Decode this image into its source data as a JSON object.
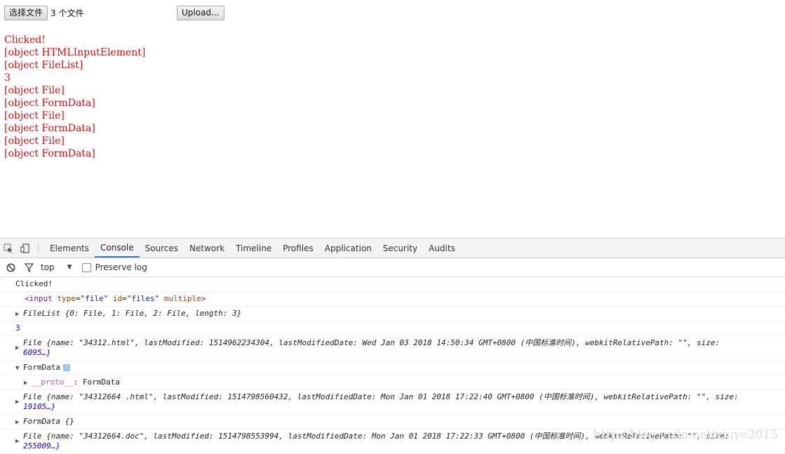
{
  "page": {
    "choose_button": "选择文件",
    "file_count": "3 个文件",
    "upload_button": "Upload...",
    "output_lines": [
      "Clicked!",
      "[object HTMLInputElement]",
      "[object FileList]",
      "3",
      "[object File]",
      "[object FormData]",
      "[object File]",
      "[object FormData]",
      "[object File]",
      "[object FormData]"
    ]
  },
  "devtools": {
    "tabs": [
      "Elements",
      "Console",
      "Sources",
      "Network",
      "Timeline",
      "Profiles",
      "Application",
      "Security",
      "Audits"
    ],
    "active_tab": "Console",
    "filter": {
      "context": "top",
      "preserve_log": "Preserve log"
    },
    "console": {
      "clicked": "Clicked!",
      "input_element": {
        "open": "<input",
        "attr1": "type",
        "val1": "\"file\"",
        "attr2": "id",
        "val2": "\"files\"",
        "attr3": "multiple",
        "close": ">"
      },
      "filelist": "FileList {0: File, 1: File, 2: File, length: 3}",
      "count": "3",
      "file1_line1": "File {name: \"34312.html\", lastModified: 1514962234304, lastModifiedDate: Wed Jan 03 2018 14:50:34 GMT+0800 (中国标准时间), webkitRelativePath: \"\", size:",
      "file1_line2": "6095…}",
      "formdata1": "FormData",
      "formdata1_info": "i",
      "proto_key": "__proto__",
      "proto_val": ": FormData",
      "file2_line1": "File {name: \"34312664 .html\", lastModified: 1514798560432, lastModifiedDate: Mon Jan 01 2018 17:22:40 GMT+0800 (中国标准时间), webkitRelativePath: \"\", size:",
      "file2_line2": "19105…}",
      "formdata2": "FormData {}",
      "file3_line1": "File {name: \"34312664.doc\", lastModified: 1514798553994, lastModifiedDate: Mon Jan 01 2018 17:22:33 GMT+0800 (中国标准时间), webkitRelativePath: \"\", size:",
      "file3_line2": "255009…}"
    }
  },
  "watermark": "http://blog.csdn.net/xiuye2015",
  "colors": {
    "output_text": "#d01010",
    "active_tab_underline": "#3879d9"
  }
}
